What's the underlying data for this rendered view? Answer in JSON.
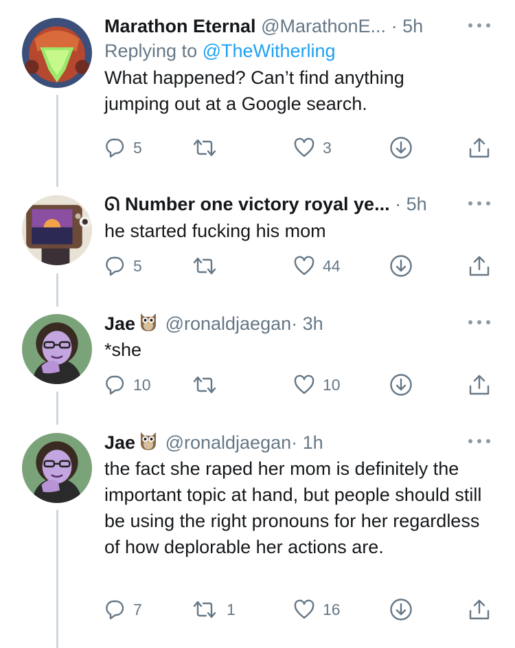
{
  "tweets": [
    {
      "name": "Marathon Eternal",
      "handle": "@MarathonE...",
      "time": "· 5h",
      "replying_prefix": "Replying to ",
      "replying_to": "@TheWitherling",
      "text": "What happened? Can’t find anything jumping out at a Google search.",
      "replies": "5",
      "retweets": "",
      "likes": "3",
      "avatar": "samus-helmet-avatar"
    },
    {
      "name_prefix": "ᘏ",
      "name": "Number one victory royal ye...",
      "handle": "",
      "time": "· 5h",
      "text": "he started fucking his mom",
      "replies": "5",
      "retweets": "",
      "likes": "44",
      "avatar": "retro-tv-avatar"
    },
    {
      "name": "Jae",
      "handle": "@ronaldjaegan",
      "time": "· 3h",
      "text": "*she",
      "replies": "10",
      "retweets": "",
      "likes": "10",
      "avatar": "purple-portrait-avatar"
    },
    {
      "name": "Jae",
      "handle": "@ronaldjaegan",
      "time": "· 1h",
      "text": "the fact she raped her mom is definitely the important topic at hand, but people should still be using the right pronouns for her regardless of how deplorable her actions are.",
      "replies": "7",
      "retweets": "1",
      "likes": "16",
      "avatar": "purple-portrait-avatar"
    }
  ],
  "icons": {
    "reply": "reply-icon",
    "retweet": "retweet-icon",
    "like": "heart-icon",
    "save": "download-icon",
    "share": "share-icon",
    "more": "more-dots-icon",
    "owl": "owl-emoji-icon"
  },
  "colors": {
    "link": "#1da1f2",
    "secondary": "#657786",
    "text": "#14171a",
    "thread_line": "#ccd6dd"
  }
}
